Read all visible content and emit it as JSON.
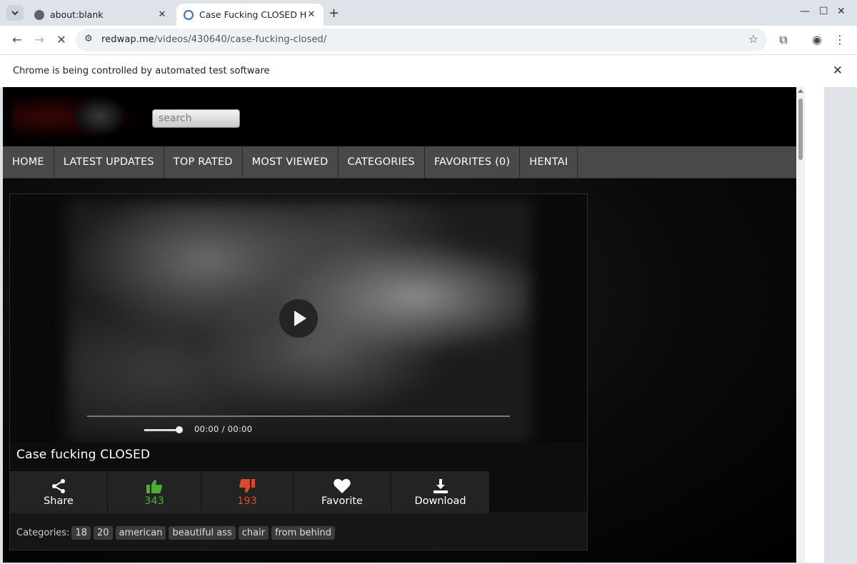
{
  "browser": {
    "tabs": [
      {
        "title": "about:blank",
        "active": false
      },
      {
        "title": "Case Fucking CLOSED HQ",
        "active": true
      }
    ],
    "new_tab_label": "+",
    "url_host": "redwap.me",
    "url_path": "/videos/430640/case-fucking-closed/",
    "infobar_text": "Chrome is being controlled by automated test software"
  },
  "site": {
    "search_placeholder": "search",
    "nav": [
      "HOME",
      "LATEST UPDATES",
      "TOP RATED",
      "MOST VIEWED",
      "CATEGORIES",
      "FAVORITES (0)",
      "HENTAI"
    ]
  },
  "video": {
    "title": "Case fucking CLOSED",
    "timecode": "00:00 / 00:00",
    "volume_level": 0.85,
    "progress": 0
  },
  "actions": {
    "share": "Share",
    "likes": "343",
    "dislikes": "193",
    "favorite": "Favorite",
    "download": "Download"
  },
  "categories": {
    "label": "Categories:",
    "tags": [
      "18",
      "20",
      "american",
      "beautiful ass",
      "chair",
      "from behind"
    ]
  },
  "colors": {
    "like": "#4caf32",
    "dislike": "#d84a2a",
    "nav_bg": "#494949"
  }
}
